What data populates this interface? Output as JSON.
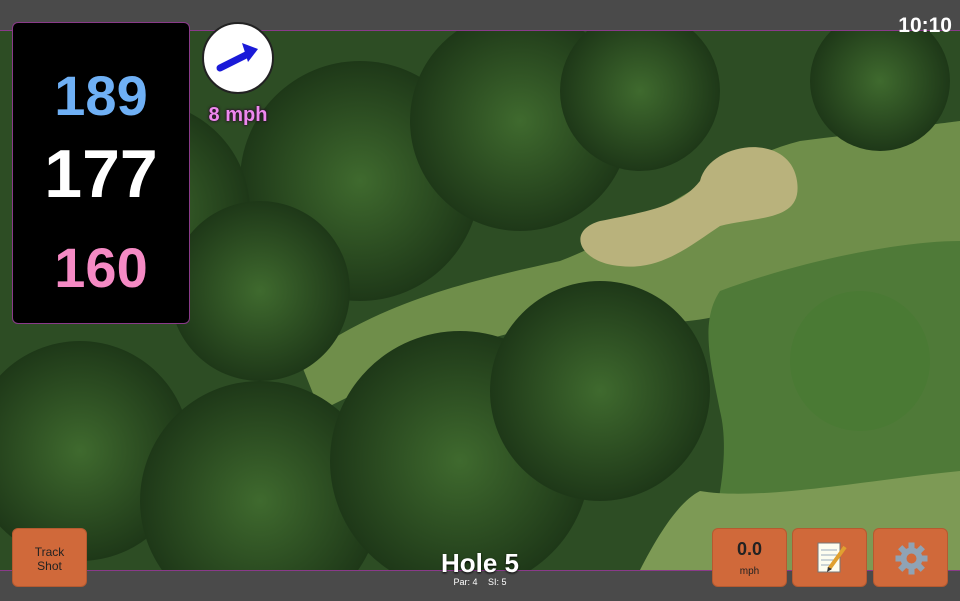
{
  "status": {
    "time": "10:10"
  },
  "distances": {
    "back": "189",
    "middle": "177",
    "front": "160"
  },
  "wind": {
    "speed": "8 mph",
    "icon": "wind-arrow-icon",
    "arrow_color": "#1a1ad8"
  },
  "hole": {
    "title": "Hole 5",
    "par": "Par: 4",
    "si": "SI: 5"
  },
  "buttons": {
    "track_shot": [
      "Track",
      "Shot"
    ],
    "speed_value": "0.0",
    "speed_unit": "mph",
    "notes_icon": "notepad-icon",
    "settings_icon": "gear-icon"
  },
  "colors": {
    "back": "#6fb0f5",
    "middle": "#ffffff",
    "front": "#f58ac4",
    "button": "#d0693a",
    "accent": "#8a3a8a"
  }
}
